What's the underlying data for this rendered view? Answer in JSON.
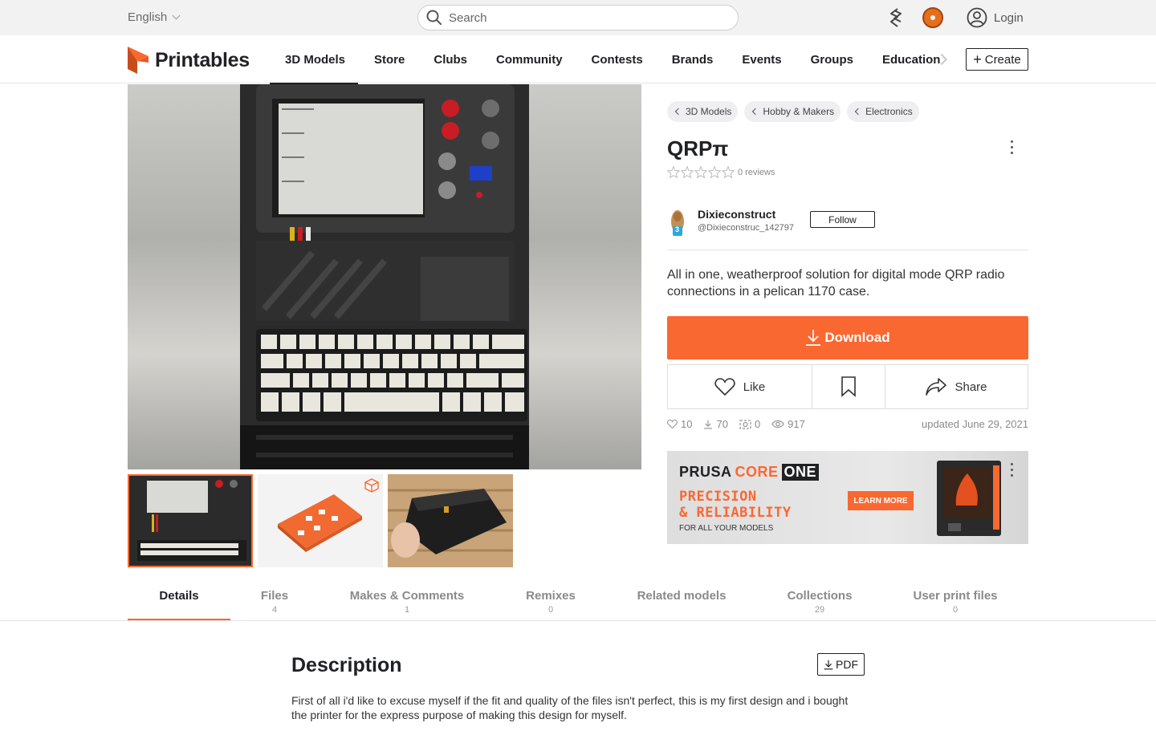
{
  "topbar": {
    "language": "English",
    "search_placeholder": "Search",
    "login_label": "Login"
  },
  "nav": {
    "logo_text": "Printables",
    "links": [
      "3D Models",
      "Store",
      "Clubs",
      "Community",
      "Contests",
      "Brands",
      "Events",
      "Groups",
      "Education"
    ],
    "create_label": "Create"
  },
  "breadcrumbs": [
    "3D Models",
    "Hobby & Makers",
    "Electronics"
  ],
  "model": {
    "title": "QRPπ",
    "reviews": "0 reviews",
    "summary": "All in one, weatherproof solution for digital mode QRP radio connections in a pelican 1170 case.",
    "updated": "updated June 29, 2021"
  },
  "author": {
    "name": "Dixieconstruct",
    "handle": "@Dixieconstruc_142797",
    "level": "3",
    "follow_label": "Follow"
  },
  "actions": {
    "download_label": "Download",
    "like_label": "Like",
    "share_label": "Share"
  },
  "stats": {
    "likes": "10",
    "downloads": "70",
    "makes": "0",
    "views": "917"
  },
  "ad": {
    "brand_prusa": "PRUSA",
    "brand_core": "CORE",
    "brand_one": "ONE",
    "headline_1": "PRECISION",
    "headline_2": "& RELIABILITY",
    "subline": "FOR ALL YOUR MODELS",
    "cta": "LEARN MORE"
  },
  "tabs": [
    {
      "label": "Details",
      "count": ""
    },
    {
      "label": "Files",
      "count": "4"
    },
    {
      "label": "Makes & Comments",
      "count": "1"
    },
    {
      "label": "Remixes",
      "count": "0"
    },
    {
      "label": "Related models",
      "count": ""
    },
    {
      "label": "Collections",
      "count": "29"
    },
    {
      "label": "User print files",
      "count": "0"
    }
  ],
  "description": {
    "title": "Description",
    "pdf_label": "PDF",
    "text": "First of all i'd like to excuse myself if the fit and quality of the files isn't perfect, this is my first design and i bought the printer for the express purpose of making this design for myself."
  },
  "colors": {
    "accent": "#fa6831",
    "text": "#202124",
    "muted": "#8a8a8a"
  }
}
